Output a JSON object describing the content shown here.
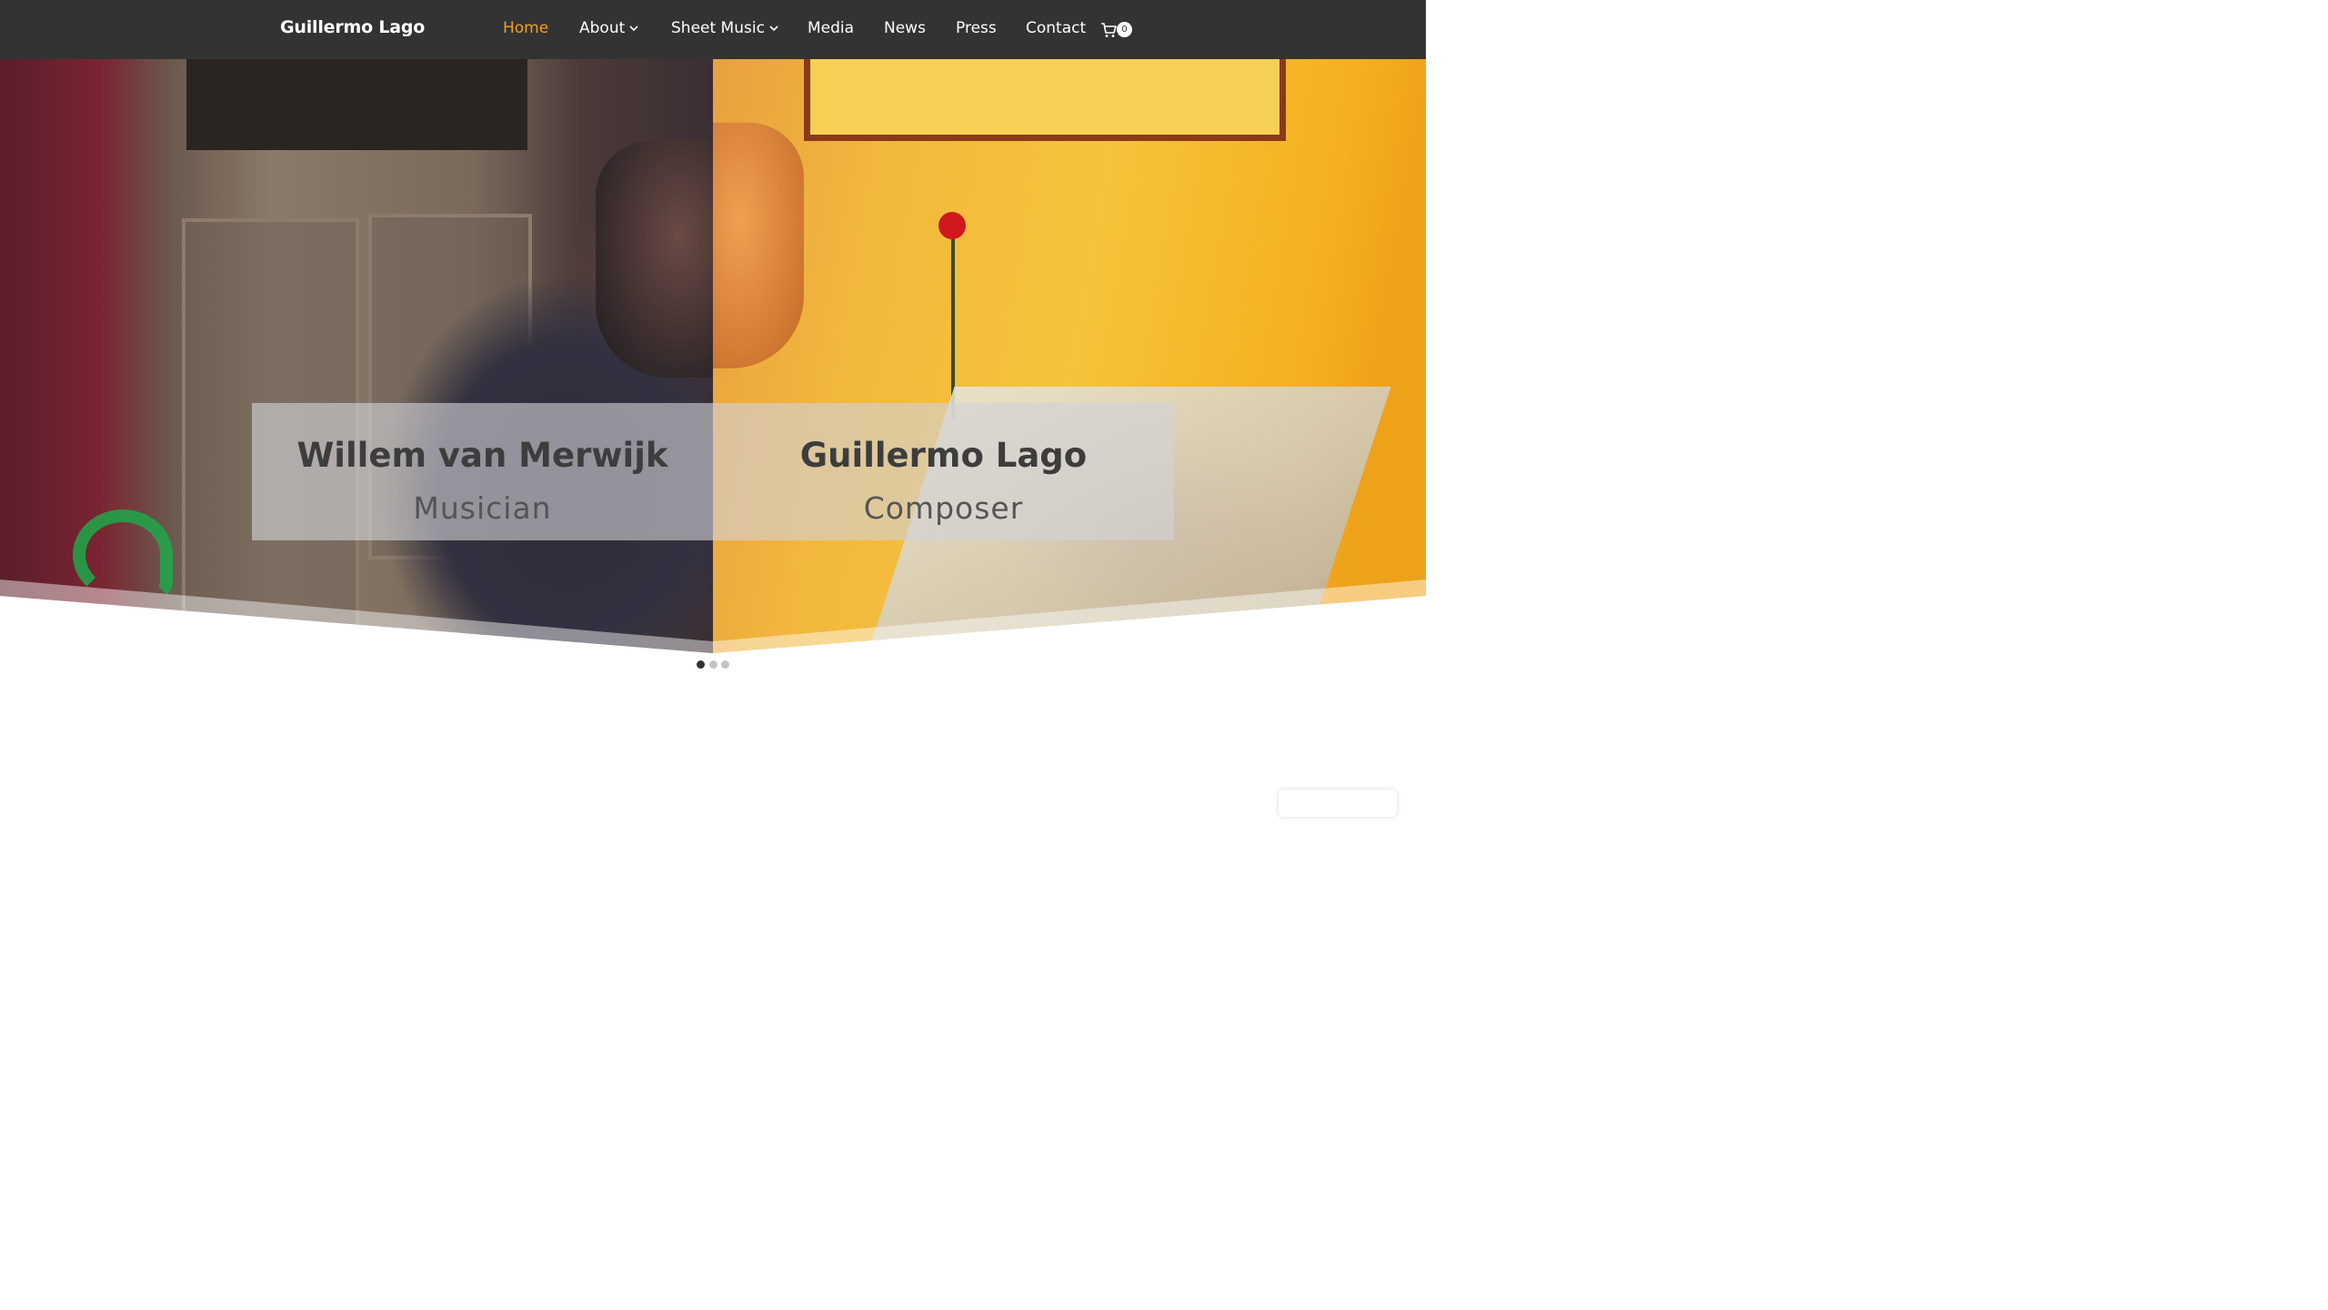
{
  "header": {
    "logo": "Guillermo Lago",
    "nav": [
      {
        "label": "Home",
        "active": true
      },
      {
        "label": "About",
        "has_dropdown": true
      },
      {
        "label": "Sheet Music",
        "has_dropdown": true
      },
      {
        "label": "Media"
      },
      {
        "label": "News"
      },
      {
        "label": "Press"
      },
      {
        "label": "Contact"
      }
    ],
    "cart_icon": "shopping-cart-icon",
    "cart_count": "0",
    "accent_color": "#f0a023",
    "background_color": "#333333"
  },
  "hero": {
    "left": {
      "name": "Willem van Merwijk",
      "role": "Musician"
    },
    "right": {
      "name": "Guillermo Lago",
      "role": "Composer"
    }
  },
  "slider": {
    "slide_count": 3,
    "active_index": 0
  }
}
